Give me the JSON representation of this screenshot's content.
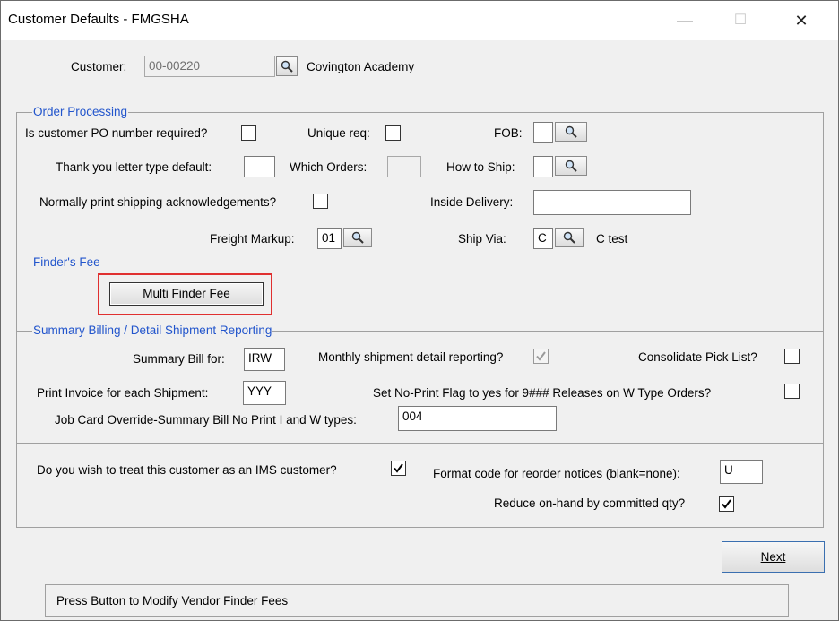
{
  "window": {
    "title": "Customer Defaults - FMGSHA",
    "minimize": "—",
    "maximize": "☐",
    "close": "✕"
  },
  "customer": {
    "label": "Customer:",
    "value": "00-00220",
    "name": "Covington Academy"
  },
  "order_processing": {
    "title": "Order Processing",
    "po_required_label": "Is customer PO number required?",
    "unique_req_label": "Unique req:",
    "fob_label": "FOB:",
    "fob_value": "",
    "thank_you_label": "Thank you letter type default:",
    "thank_you_value": "",
    "which_orders_label": "Which Orders:",
    "which_orders_value": "",
    "how_to_ship_label": "How to Ship:",
    "how_to_ship_value": "",
    "print_ack_label": "Normally print shipping acknowledgements?",
    "inside_delivery_label": "Inside Delivery:",
    "inside_delivery_value": "",
    "freight_markup_label": "Freight Markup:",
    "freight_markup_value": "01",
    "ship_via_label": "Ship Via:",
    "ship_via_value": "C",
    "ship_via_desc": "C test"
  },
  "finders_fee": {
    "title": "Finder's Fee",
    "button": "Multi Finder Fee"
  },
  "summary_billing": {
    "title": "Summary Billing / Detail Shipment Reporting",
    "summary_bill_label": "Summary Bill for:",
    "summary_bill_value": "IRW",
    "monthly_label": "Monthly shipment detail reporting?",
    "monthly_checked": true,
    "consolidate_label": "Consolidate Pick List?",
    "print_invoice_label": "Print Invoice for each Shipment:",
    "print_invoice_value": "YYY",
    "no_print_label": "Set No-Print Flag to yes for 9### Releases on W Type Orders?",
    "job_card_label": "Job Card Override-Summary Bill No Print I and W types:",
    "job_card_value": "004"
  },
  "ims": {
    "ims_label": "Do you wish to treat this customer as an IMS customer?",
    "ims_checked": true,
    "format_code_label": "Format code for reorder notices (blank=none):",
    "format_code_value": "U",
    "reduce_label": "Reduce on-hand by committed qty?",
    "reduce_checked": true
  },
  "next_button": "Next",
  "status_text": "Press Button to Modify Vendor Finder Fees",
  "colors": {
    "group_title": "#2255cc",
    "highlight_box": "#e03030"
  }
}
